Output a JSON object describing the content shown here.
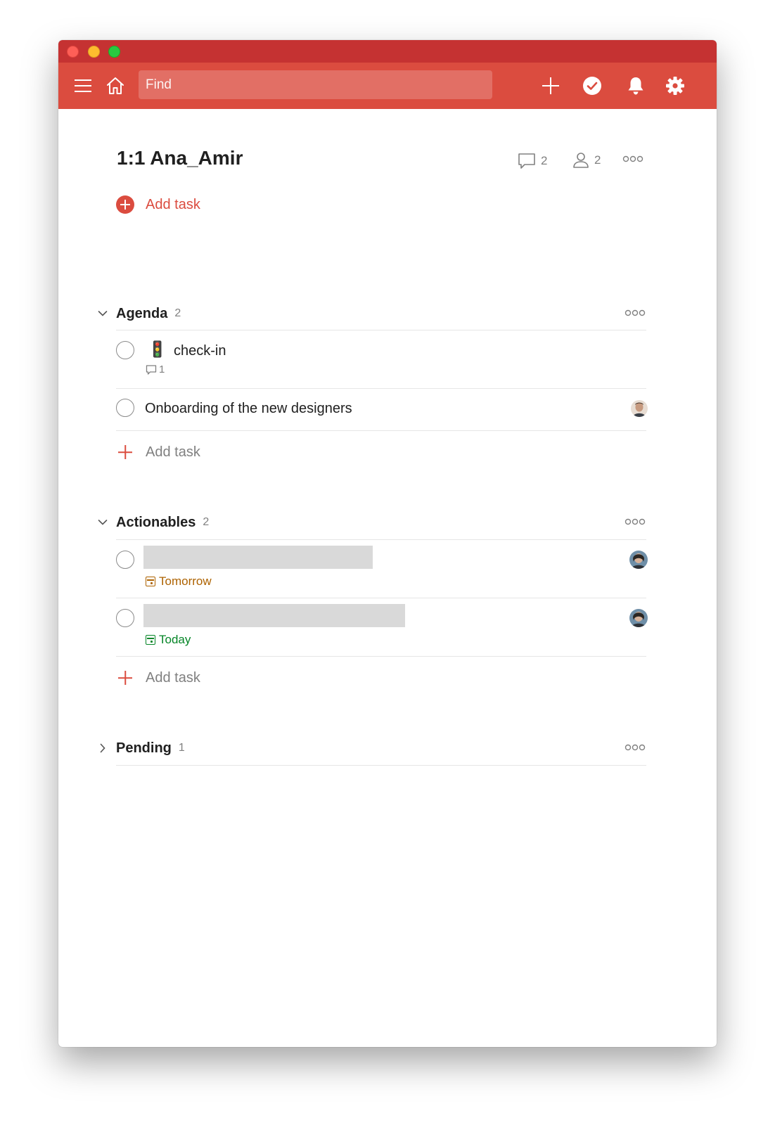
{
  "toolbar": {
    "search_placeholder": "Find"
  },
  "project": {
    "title": "1:1 Ana_Amir",
    "comment_count": "2",
    "member_count": "2",
    "add_task_label": "Add task"
  },
  "sections": [
    {
      "name": "Agenda",
      "count": "2",
      "expanded": true,
      "tasks": [
        {
          "emoji": "🚦",
          "text": "check-in",
          "comment_count": "1"
        },
        {
          "text": "Onboarding of the new designers"
        }
      ],
      "add_task_label": "Add task"
    },
    {
      "name": "Actionables",
      "count": "2",
      "expanded": true,
      "tasks": [
        {
          "due": "Tomorrow",
          "due_color": "#ad6200"
        },
        {
          "due": "Today",
          "due_color": "#058527"
        }
      ],
      "add_task_label": "Add task"
    },
    {
      "name": "Pending",
      "count": "1",
      "expanded": false
    }
  ],
  "colors": {
    "accent": "#db4c3f",
    "titlebar": "#c53232",
    "tomorrow": "#ad6200",
    "today": "#058527"
  }
}
